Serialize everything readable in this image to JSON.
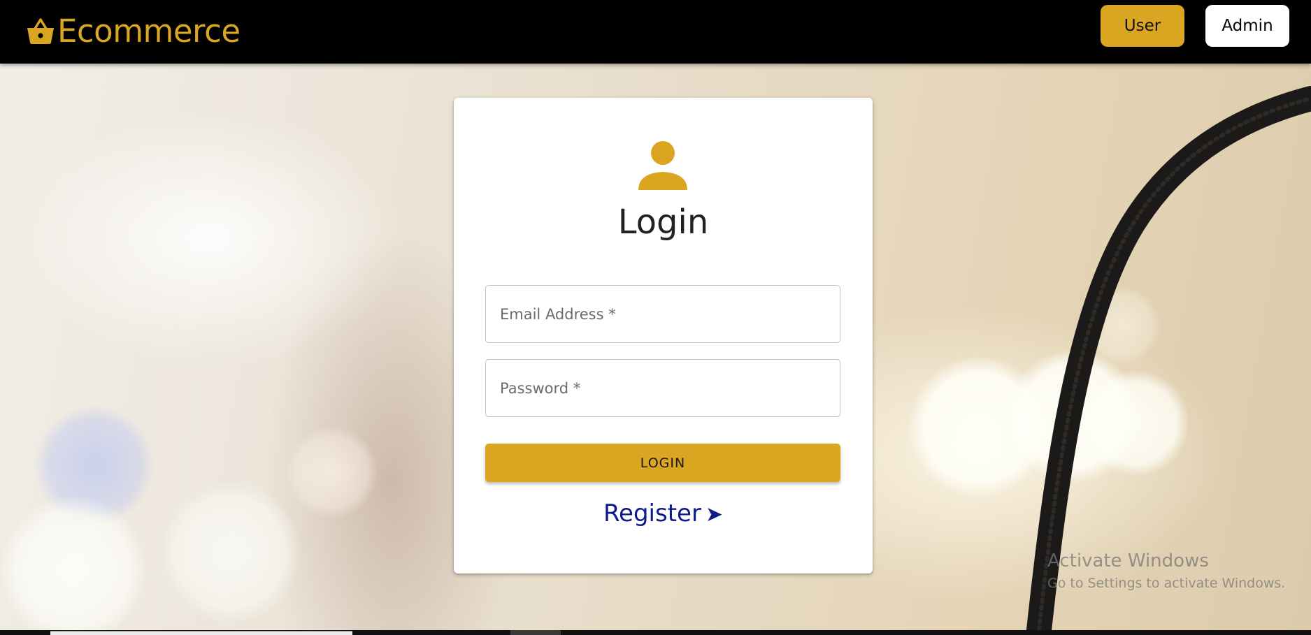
{
  "app": {
    "brand_name": "Ecommerce",
    "brand_icon": "shopping-basket-icon",
    "accent_color": "#daa520",
    "topbar_color": "#000000"
  },
  "nav": {
    "user_label": "User",
    "admin_label": "Admin"
  },
  "login": {
    "icon": "person-icon",
    "title": "Login",
    "email_placeholder": "Email Address *",
    "email_value": "",
    "password_placeholder": "Password *",
    "password_value": "",
    "submit_label": "LOGIN",
    "register_label": "Register",
    "register_arrow": "➤",
    "link_color": "#0d1b8c"
  },
  "watermark": {
    "title": "Activate Windows",
    "subtitle": "Go to Settings to activate Windows."
  }
}
